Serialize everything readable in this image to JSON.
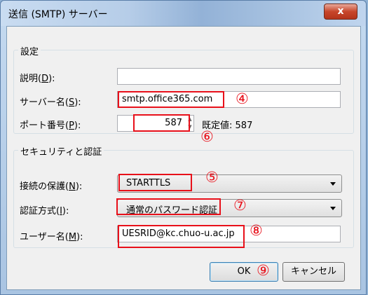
{
  "window": {
    "title": "送信 (SMTP) サーバー",
    "close_glyph": "x"
  },
  "settings": {
    "group_title": "設定",
    "description_label_pre": "説明(",
    "description_label_key": "D",
    "description_label_post": "):",
    "description_value": "",
    "server_label_pre": "サーバー名(",
    "server_label_key": "S",
    "server_label_post": "):",
    "server_value": "smtp.office365.com",
    "port_label_pre": "ポート番号(",
    "port_label_key": "P",
    "port_label_post": "):",
    "port_value": "587",
    "default_label": "既定値:",
    "default_value": "587"
  },
  "security": {
    "group_title": "セキュリティと認証",
    "connection_label_pre": "接続の保護(",
    "connection_label_key": "N",
    "connection_label_post": "):",
    "connection_value": "STARTTLS",
    "auth_label_pre": "認証方式(",
    "auth_label_key": "I",
    "auth_label_post": "):",
    "auth_value": "通常のパスワード認証",
    "user_label_pre": "ユーザー名(",
    "user_label_key": "M",
    "user_label_post": "):",
    "user_value": "UESRID@kc.chuo-u.ac.jp"
  },
  "buttons": {
    "ok": "OK",
    "cancel": "キャンセル"
  },
  "annotations": {
    "n4": "④",
    "n5": "⑤",
    "n6": "⑥",
    "n7": "⑦",
    "n8": "⑧",
    "n9": "⑨"
  },
  "colors": {
    "annotation_red": "#e8101a",
    "close_button": "#c7462b"
  }
}
